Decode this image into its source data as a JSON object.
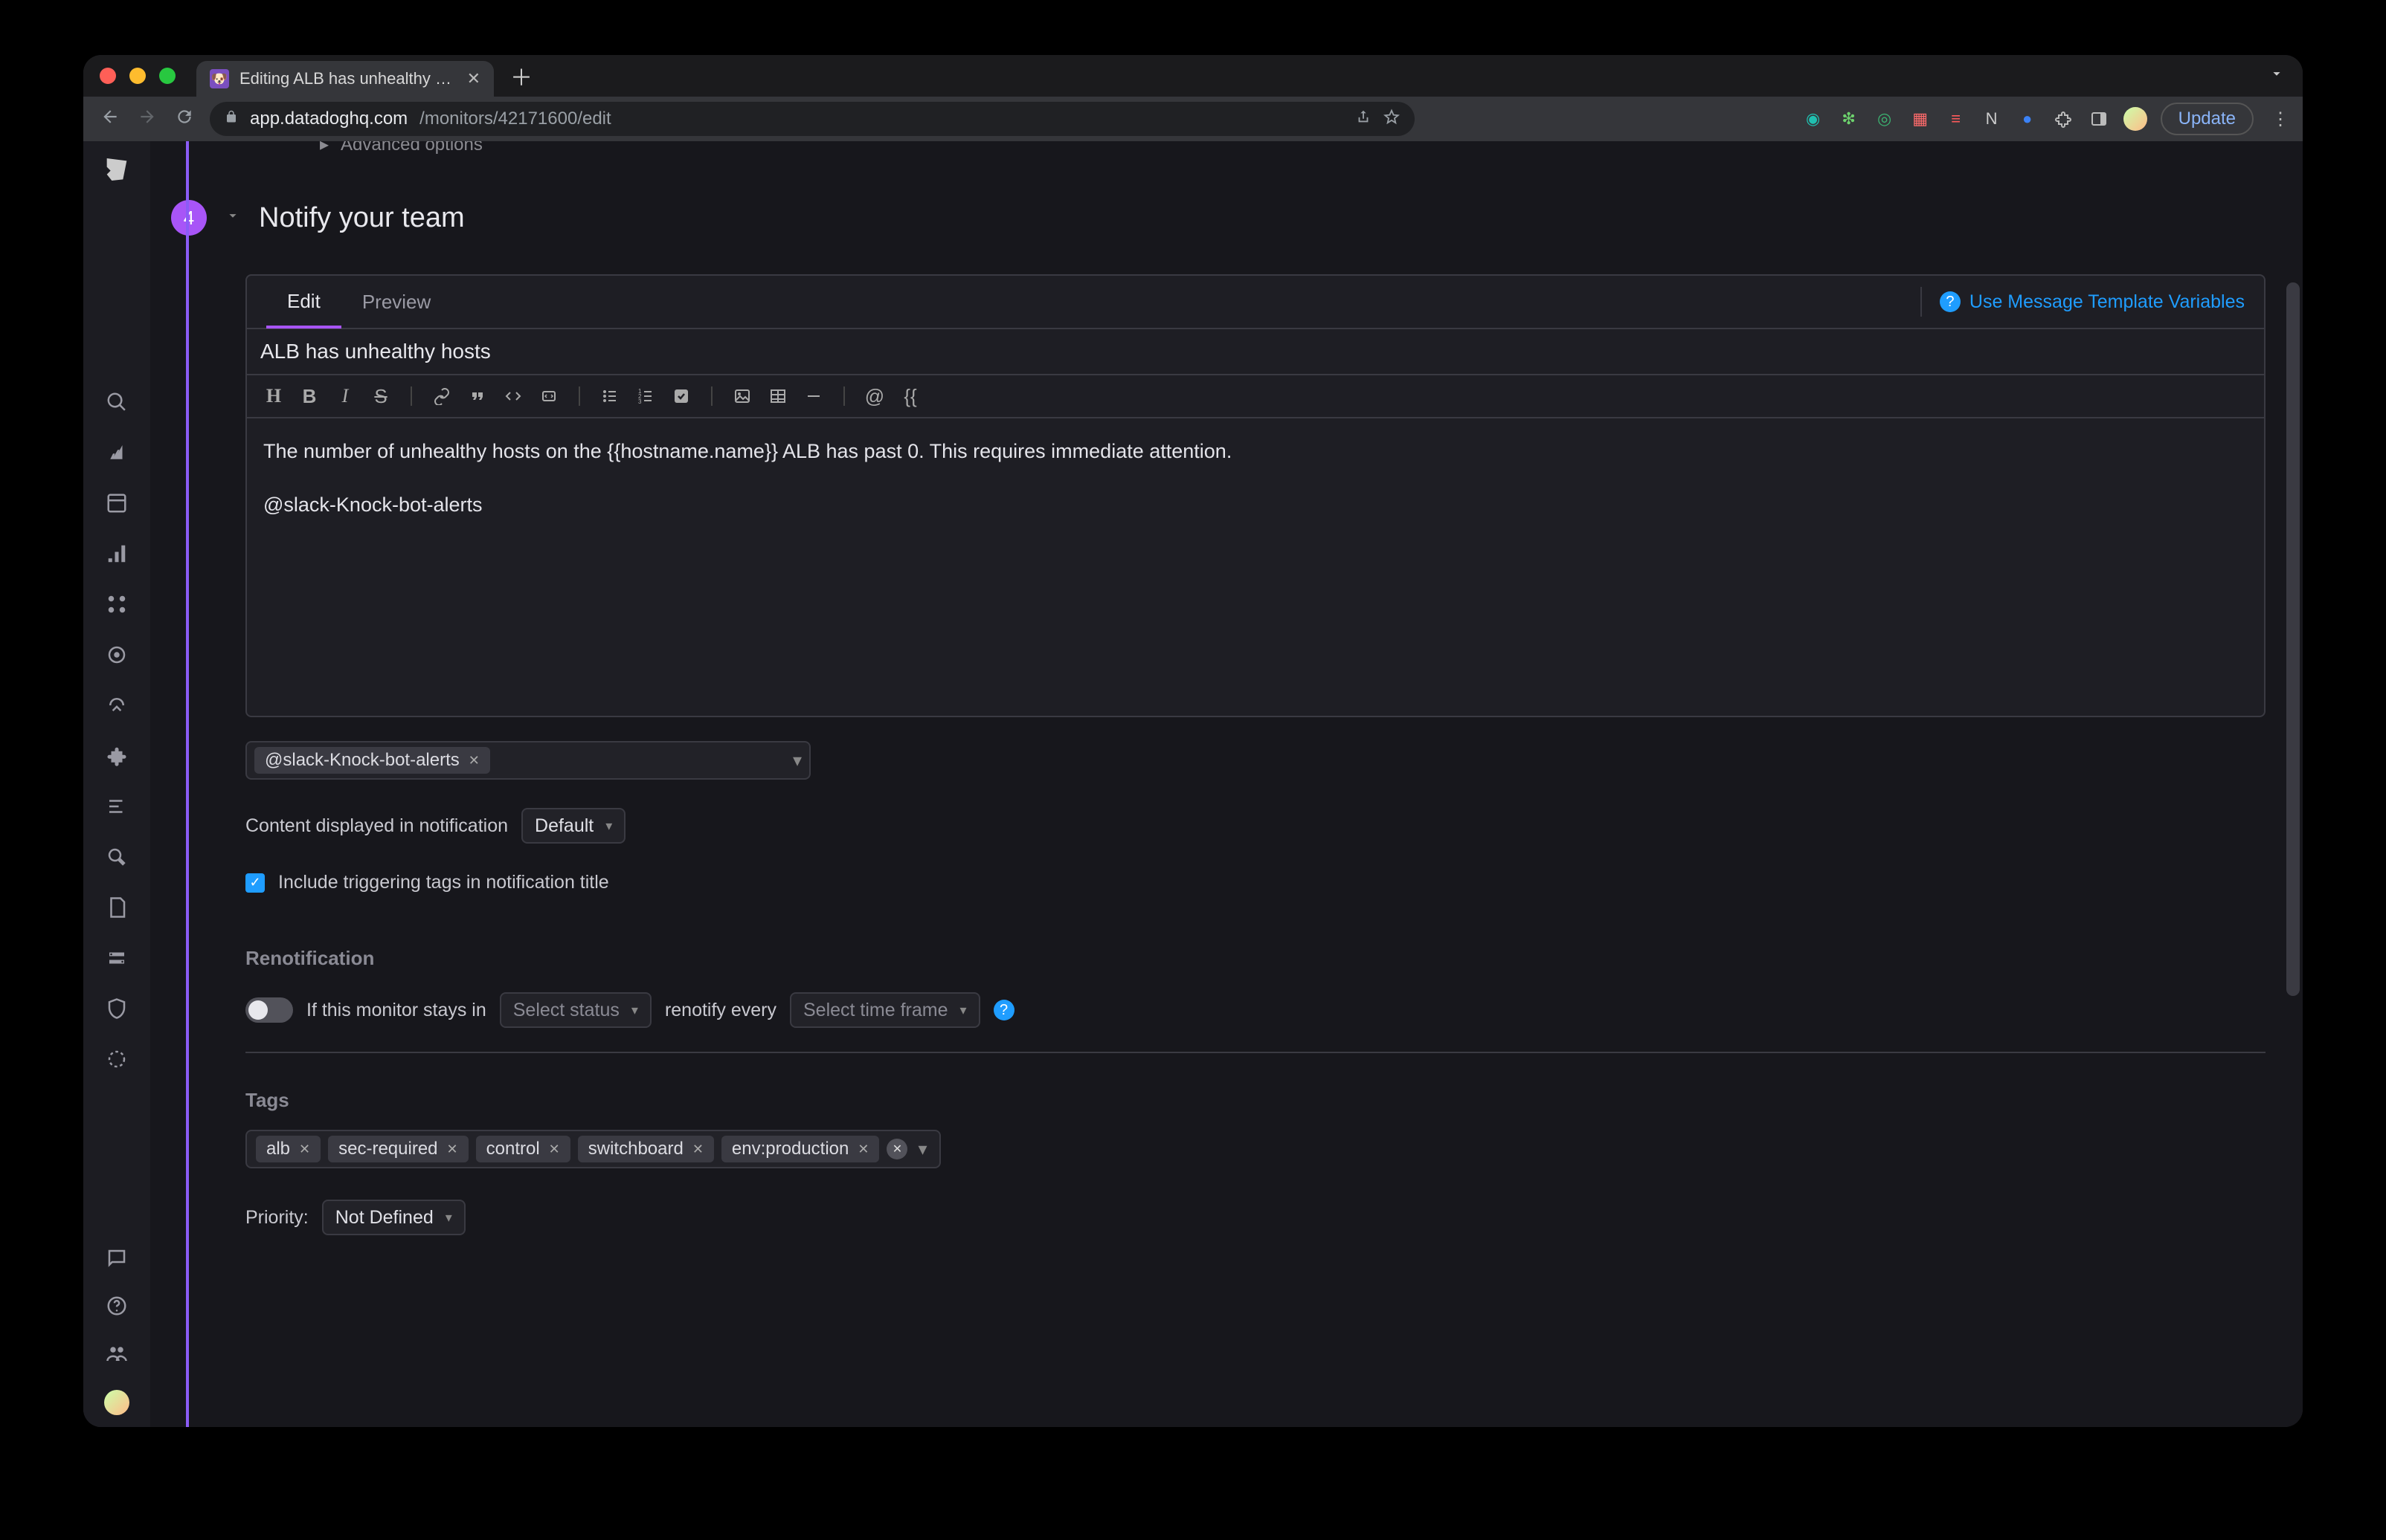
{
  "browser": {
    "tab_title": "Editing ALB has unhealthy hos…",
    "url_domain": "app.datadoghq.com",
    "url_path": "/monitors/42171600/edit",
    "update_button": "Update"
  },
  "page": {
    "advanced_options": "Advanced options",
    "step": "4",
    "section_title": "Notify your team"
  },
  "editor": {
    "tabs": {
      "edit": "Edit",
      "preview": "Preview"
    },
    "template_link": "Use Message Template Variables",
    "subject": "ALB has unhealthy hosts",
    "body_line1": "The number of unhealthy hosts on the {{hostname.name}} ALB has past 0. This requires immediate attention.",
    "body_line2": "@slack-Knock-bot-alerts",
    "toolbar": {
      "heading": "H",
      "bold": "B",
      "italic": "I",
      "strike": "S",
      "mention": "@",
      "template": "{{"
    }
  },
  "recipients": {
    "chip": "@slack-Knock-bot-alerts"
  },
  "content_display": {
    "label": "Content displayed in notification",
    "value": "Default"
  },
  "include_tags": {
    "label": "Include triggering tags in notification title"
  },
  "renotification": {
    "heading": "Renotification",
    "text1": "If this monitor stays in",
    "status_placeholder": "Select status",
    "text2": "renotify every",
    "timeframe_placeholder": "Select time frame"
  },
  "tags": {
    "heading": "Tags",
    "items": [
      "alb",
      "sec-required",
      "control",
      "switchboard",
      "env:production"
    ]
  },
  "priority": {
    "label": "Priority:",
    "value": "Not Defined"
  }
}
